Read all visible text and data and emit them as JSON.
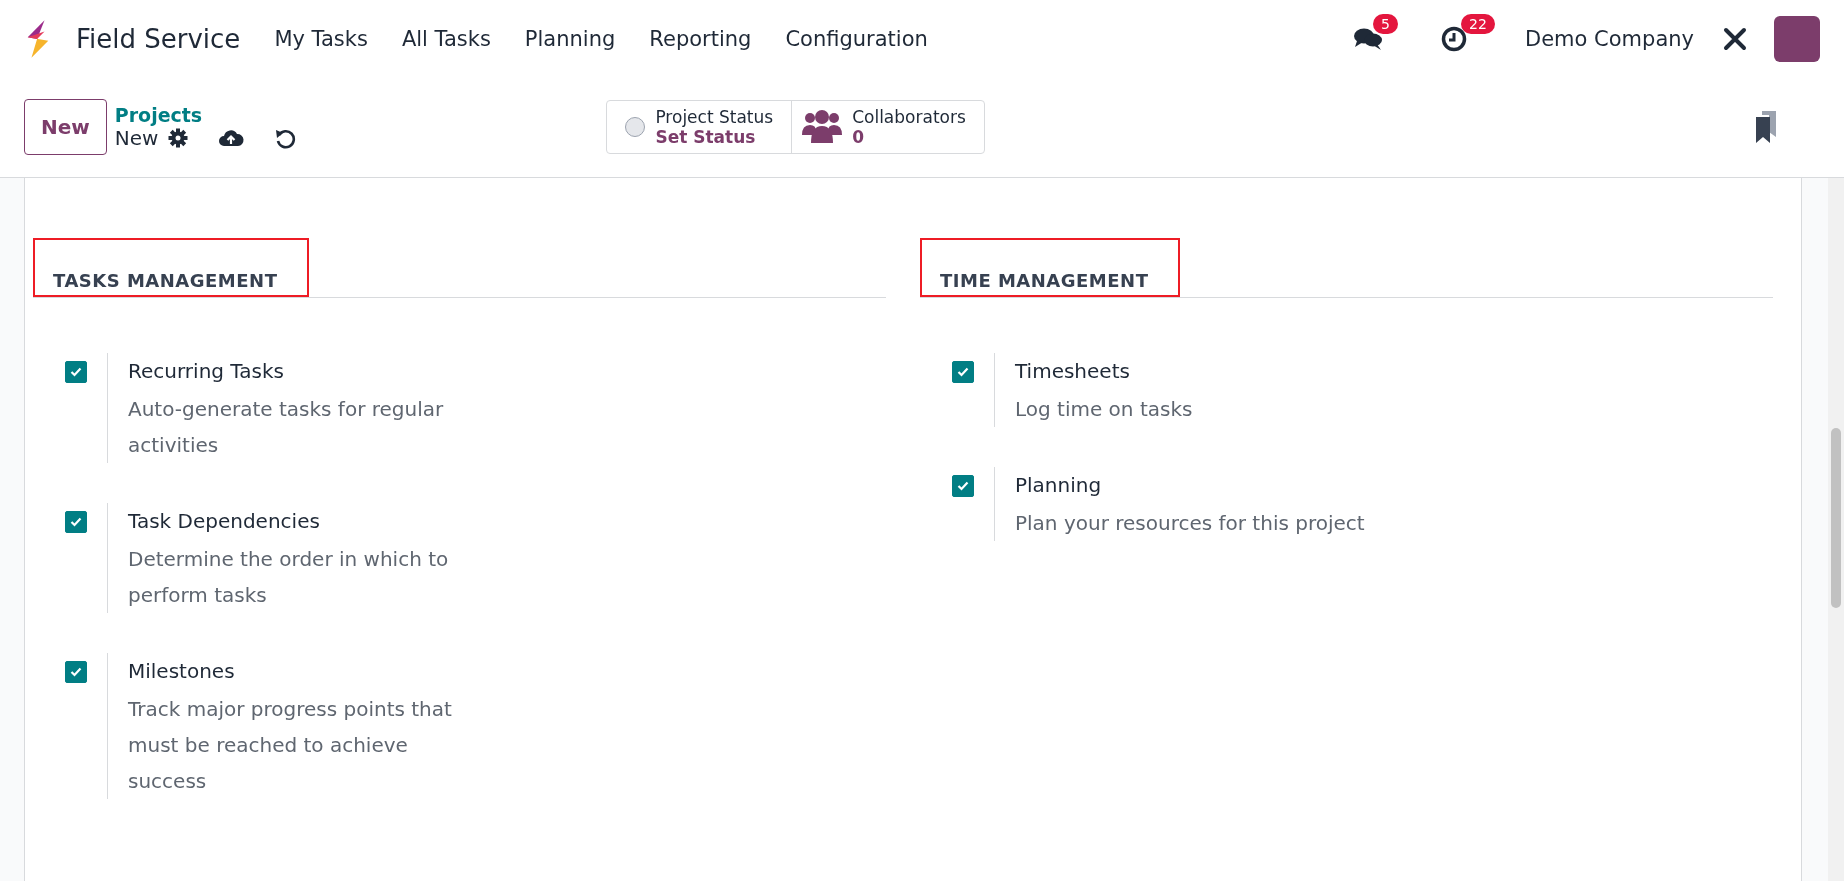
{
  "navbar": {
    "app_name": "Field Service",
    "menu": [
      "My Tasks",
      "All Tasks",
      "Planning",
      "Reporting",
      "Configuration"
    ],
    "messages_badge": "5",
    "activities_badge": "22",
    "company": "Demo Company"
  },
  "control_panel": {
    "new_button": "New",
    "breadcrumb": "Projects",
    "record_title": "New",
    "status_label": "Project Status",
    "status_value": "Set Status",
    "collaborators_label": "Collaborators",
    "collaborators_count": "0"
  },
  "sections": [
    {
      "title": "TASKS MANAGEMENT",
      "highlighted": true,
      "settings": [
        {
          "label": "Recurring Tasks",
          "description": "Auto-generate tasks for regular activities",
          "checked": true
        },
        {
          "label": "Task Dependencies",
          "description": "Determine the order in which to perform tasks",
          "checked": true
        },
        {
          "label": "Milestones",
          "description": "Track major progress points that must be reached to achieve success",
          "checked": true
        }
      ]
    },
    {
      "title": "TIME MANAGEMENT",
      "highlighted": true,
      "settings": [
        {
          "label": "Timesheets",
          "description": "Log time on tasks",
          "checked": true
        },
        {
          "label": "Planning",
          "description": "Plan your resources for this project",
          "checked": true
        }
      ]
    }
  ]
}
